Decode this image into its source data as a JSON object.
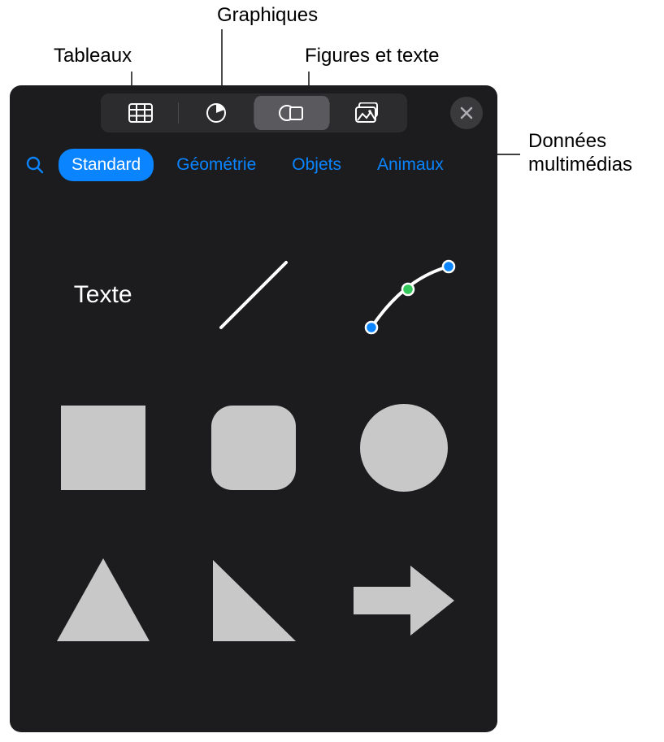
{
  "callouts": {
    "tables": "Tableaux",
    "charts": "Graphiques",
    "shapes_text": "Figures et texte",
    "media": "Données\nmultimédias"
  },
  "filter": {
    "standard": "Standard",
    "geometry": "Géométrie",
    "objects": "Objets",
    "animals": "Animaux"
  },
  "shapes": {
    "text_label": "Texte"
  },
  "icons": {
    "tables": "table-icon",
    "charts": "piechart-icon",
    "shapes": "shapes-icon",
    "media": "media-icon",
    "close": "close-icon",
    "search": "search-icon"
  }
}
